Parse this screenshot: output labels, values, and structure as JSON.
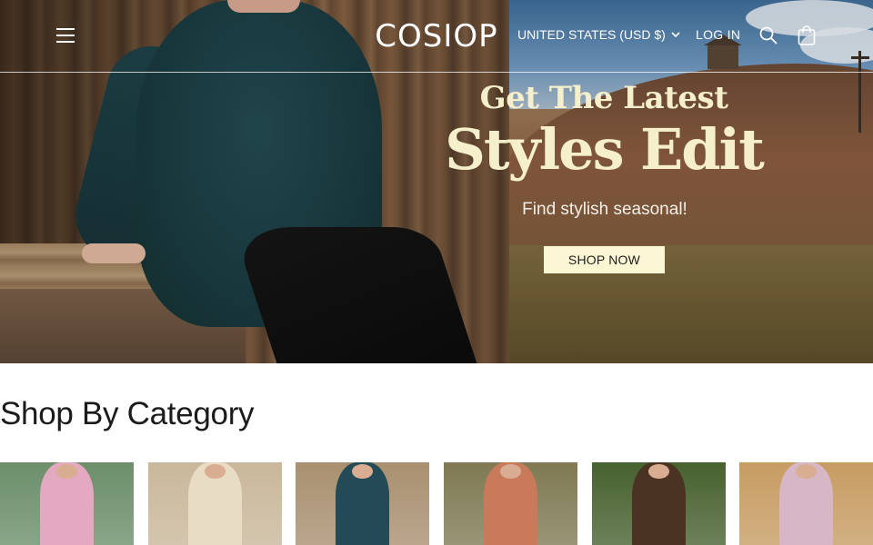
{
  "header": {
    "logo": "COSIOP",
    "currency": "UNITED STATES (USD $)",
    "login": "LOG IN"
  },
  "hero": {
    "line1": "Get The Latest",
    "line2": "Styles Edit",
    "subtitle": "Find stylish seasonal!",
    "cta": "SHOP NOW"
  },
  "categories": {
    "title": "Shop By Category",
    "items": [
      {
        "icon": "pink-striped-shirt-photo",
        "bg": "#6c8f6a",
        "fig": "#e3a9c0"
      },
      {
        "icon": "cream-knit-cardigan-photo",
        "bg": "#c9b79a",
        "fig": "#e8dcc4"
      },
      {
        "icon": "teal-dress-photo",
        "bg": "#a99070",
        "fig": "#244a56"
      },
      {
        "icon": "floral-sweater-photo",
        "bg": "#7f7a53",
        "fig": "#c97a5a"
      },
      {
        "icon": "brown-blazer-photo",
        "bg": "#47612f",
        "fig": "#4b3324"
      },
      {
        "icon": "lilac-blouse-photo",
        "bg": "#c79c63",
        "fig": "#d7b6c6"
      }
    ]
  },
  "colors": {
    "hero_text": "#f6efcc",
    "cta_bg": "#fdf6d4",
    "title_text": "#1b1b1b"
  }
}
